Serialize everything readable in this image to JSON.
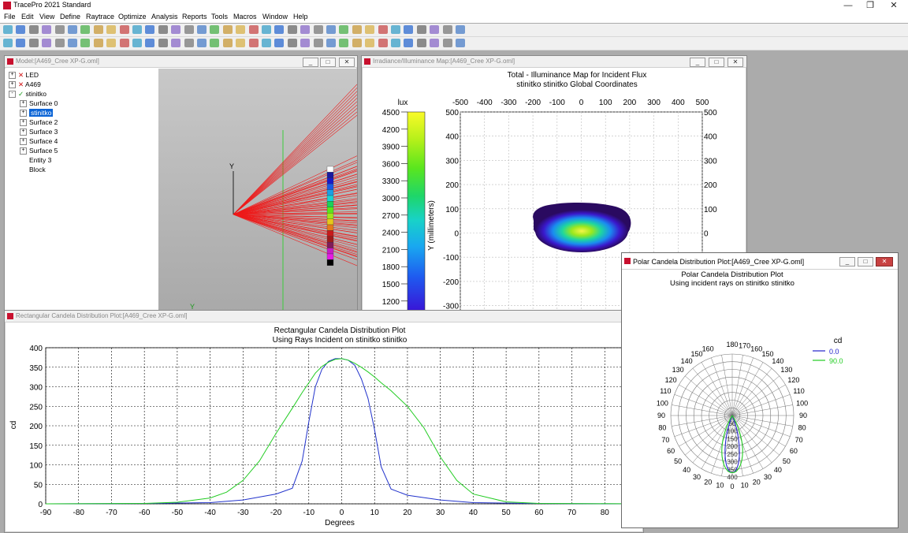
{
  "app": {
    "title": "TracePro 2021 Standard",
    "menu": [
      "File",
      "Edit",
      "View",
      "Define",
      "Raytrace",
      "Optimize",
      "Analysis",
      "Reports",
      "Tools",
      "Macros",
      "Window",
      "Help"
    ]
  },
  "window_controls": {
    "min": "—",
    "max": "❐",
    "close": "✕"
  },
  "model_window": {
    "title": "Model:[A469_Cree XP-G.oml]",
    "tree": [
      {
        "label": "LED",
        "mark": "x",
        "expander": "+"
      },
      {
        "label": "A469",
        "mark": "x",
        "expander": "+"
      },
      {
        "label": "stinitko",
        "mark": "check",
        "expander": "-"
      },
      {
        "label": "Surface 0",
        "expander": "+"
      },
      {
        "label": "stinitko",
        "expander": "+",
        "selected": true
      },
      {
        "label": "Surface 2",
        "expander": "+"
      },
      {
        "label": "Surface 3",
        "expander": "+"
      },
      {
        "label": "Surface 4",
        "expander": "+"
      },
      {
        "label": "Surface 5",
        "expander": "+"
      },
      {
        "label": "Entity 3"
      },
      {
        "label": "Block"
      }
    ],
    "axis_y": "Y",
    "axis_y2": "Y"
  },
  "irradiance_window": {
    "title": "Irradiance/Illuminance Map:[A469_Cree XP-G.oml]",
    "heading1": "Total - Illuminance Map for Incident Flux",
    "heading2": "stinitko stinitko    Global Coordinates",
    "colorbar_unit": "lux",
    "colorbar_labels": [
      "4500",
      "4200",
      "3900",
      "3600",
      "3300",
      "3000",
      "2700",
      "2400",
      "2100",
      "1800",
      "1500",
      "1200"
    ],
    "x_ticks": [
      "-500",
      "-400",
      "-300",
      "-200",
      "-100",
      "0",
      "100",
      "200",
      "300",
      "400",
      "500"
    ],
    "y_ticks": [
      "500",
      "400",
      "300",
      "200",
      "100",
      "0",
      "-100",
      "-200",
      "-300"
    ],
    "y_axis_label": "Y (millimeters)"
  },
  "rect_window": {
    "title": "Rectangular Candela Distribution Plot:[A469_Cree XP-G.oml]",
    "heading1": "Rectangular Candela Distribution Plot",
    "heading2": "Using Rays Incident on stinitko stinitko"
  },
  "polar_window": {
    "title": "Polar Candela Distribution Plot:[A469_Cree XP-G.oml]",
    "heading1": "Polar Candela Distribution Plot",
    "heading2": "Using incident rays on stinitko stinitko",
    "legend_title": "cd",
    "legend": [
      {
        "label": "0.0",
        "color": "#2222cc"
      },
      {
        "label": "90.0",
        "color": "#22cc22"
      }
    ],
    "angle_labels_left": [
      "160",
      "150",
      "140",
      "130",
      "120",
      "110",
      "100",
      "90",
      "80",
      "70",
      "60",
      "50",
      "40",
      "30",
      "20",
      "10"
    ],
    "angle_labels_right": [
      "170",
      "160",
      "150",
      "140",
      "130",
      "120",
      "110",
      "100",
      "90",
      "80",
      "70",
      "60",
      "50",
      "40",
      "30",
      "20",
      "10"
    ],
    "top_labels": [
      "170",
      "180",
      "170"
    ],
    "bottom_labels": [
      "0",
      "10"
    ],
    "radial_labels": [
      "50",
      "100",
      "150",
      "200",
      "250",
      "300",
      "350",
      "400"
    ]
  },
  "chart_data": {
    "type": "line",
    "title": "Rectangular Candela Distribution Plot",
    "subtitle": "Using Rays Incident on stinitko stinitko",
    "xlabel": "Degrees",
    "ylabel": "cd",
    "xlim": [
      -90,
      90
    ],
    "ylim": [
      0,
      400
    ],
    "x_ticks": [
      -90,
      -80,
      -70,
      -60,
      -50,
      -40,
      -30,
      -20,
      -10,
      0,
      10,
      20,
      30,
      40,
      50,
      60,
      70,
      80
    ],
    "y_ticks": [
      0,
      50,
      100,
      150,
      200,
      250,
      300,
      350,
      400
    ],
    "grid": true,
    "series": [
      {
        "color": "#2233cc",
        "x": [
          -90,
          -58,
          -40,
          -30,
          -20,
          -15,
          -12,
          -10,
          -8,
          -6,
          -4,
          -2,
          0,
          2,
          4,
          6,
          8,
          10,
          12,
          15,
          20,
          30,
          40,
          58,
          90
        ],
        "y": [
          0,
          1,
          3,
          10,
          25,
          40,
          110,
          210,
          300,
          345,
          365,
          372,
          372,
          368,
          355,
          320,
          270,
          190,
          95,
          38,
          22,
          10,
          3,
          1,
          0
        ]
      },
      {
        "color": "#22cc22",
        "x": [
          -90,
          -60,
          -50,
          -40,
          -35,
          -30,
          -25,
          -20,
          -15,
          -12,
          -10,
          -8,
          -6,
          -4,
          -2,
          0,
          2,
          4,
          6,
          8,
          10,
          12,
          15,
          20,
          25,
          30,
          35,
          40,
          50,
          60,
          90
        ],
        "y": [
          0,
          1,
          4,
          15,
          30,
          60,
          110,
          180,
          245,
          285,
          310,
          335,
          352,
          363,
          370,
          372,
          368,
          360,
          350,
          338,
          325,
          310,
          290,
          250,
          195,
          120,
          60,
          25,
          5,
          1,
          0
        ]
      }
    ]
  }
}
